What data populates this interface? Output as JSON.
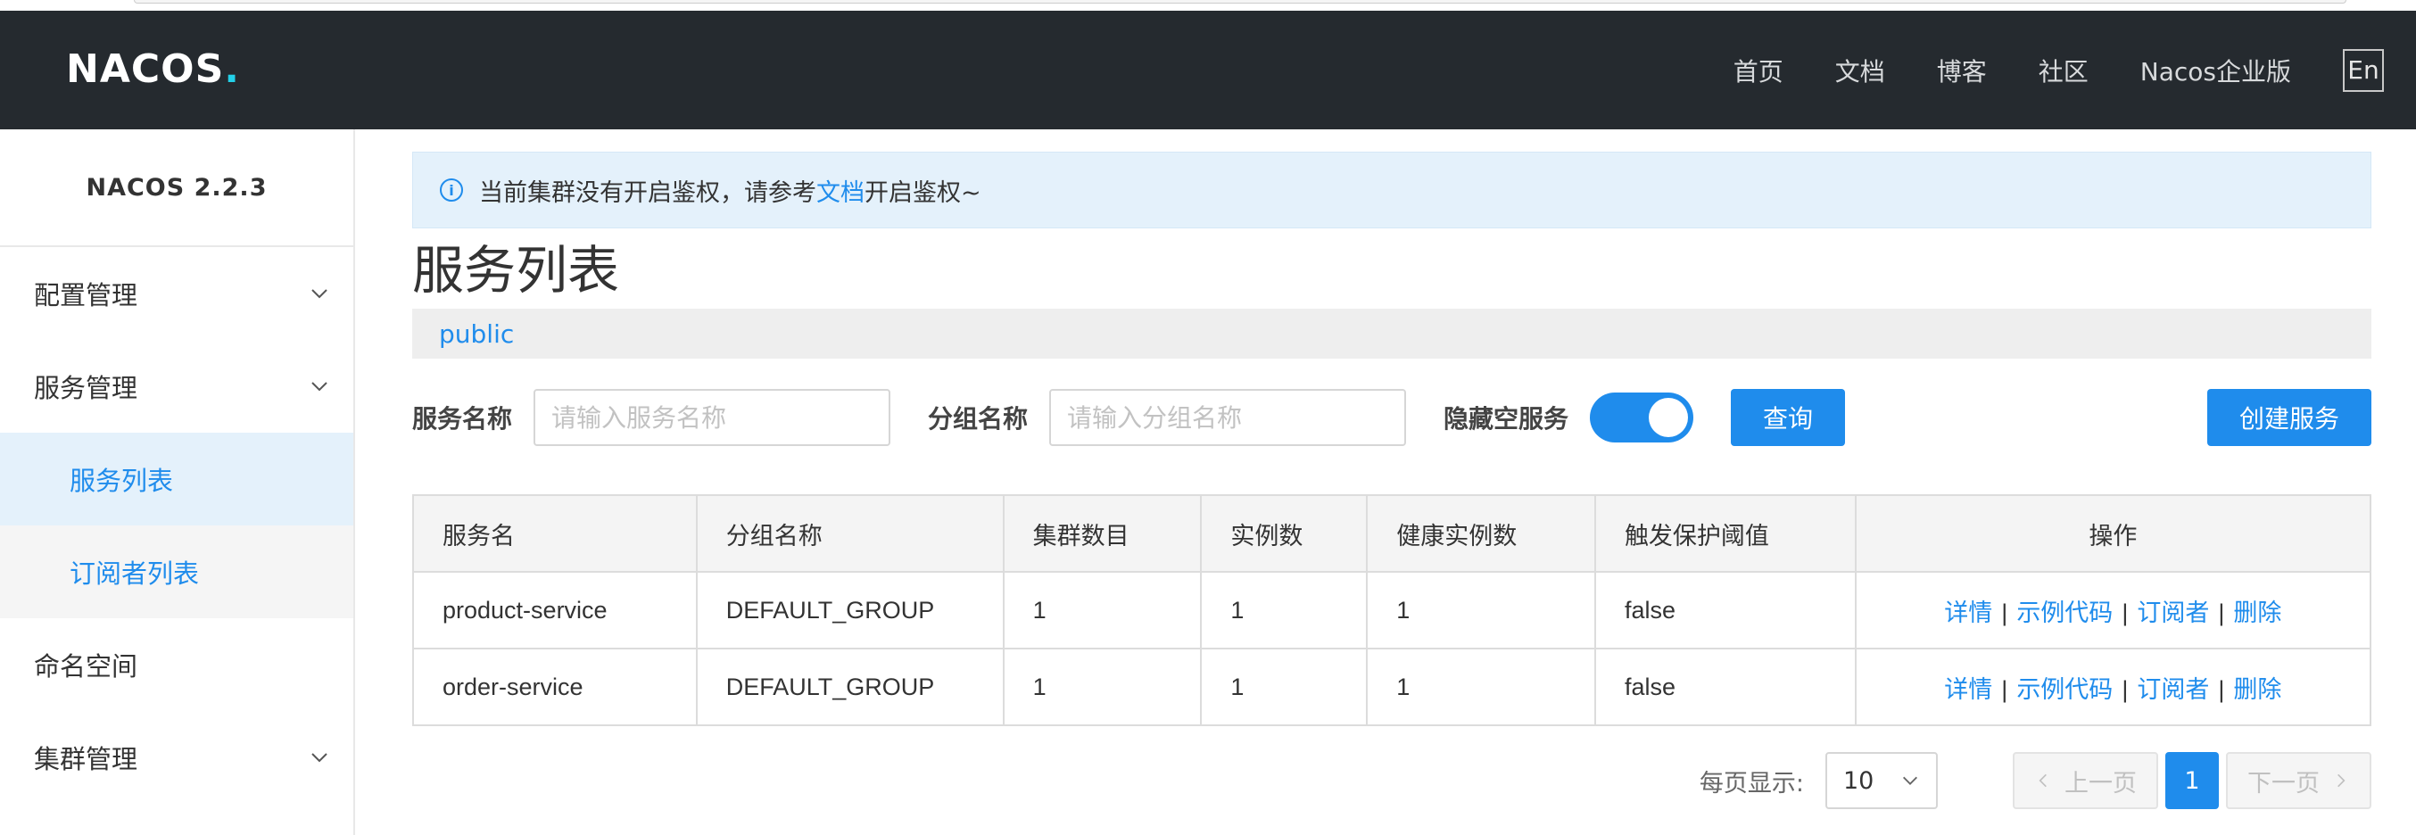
{
  "header": {
    "logo": {
      "text": "NACOS",
      "dot": "."
    },
    "nav": [
      "首页",
      "文档",
      "博客",
      "社区",
      "Nacos企业版"
    ],
    "lang": "En"
  },
  "sidebar": {
    "title": "NACOS 2.2.3",
    "items": [
      {
        "label": "配置管理",
        "expandable": true
      },
      {
        "label": "服务管理",
        "expandable": true
      },
      {
        "label": "服务列表",
        "sub": true,
        "active": true
      },
      {
        "label": "订阅者列表",
        "sub": true
      },
      {
        "label": "命名空间"
      },
      {
        "label": "集群管理",
        "expandable": true
      }
    ]
  },
  "notice": {
    "before": "当前集群没有开启鉴权，请参考",
    "link": "文档",
    "after": "开启鉴权~"
  },
  "page": {
    "title": "服务列表",
    "namespace": "public"
  },
  "filter": {
    "service_name_label": "服务名称",
    "service_name_placeholder": "请输入服务名称",
    "group_name_label": "分组名称",
    "group_name_placeholder": "请输入分组名称",
    "hide_empty_label": "隐藏空服务",
    "hide_empty_on": true,
    "query_label": "查询",
    "create_label": "创建服务"
  },
  "table": {
    "headers": [
      "服务名",
      "分组名称",
      "集群数目",
      "实例数",
      "健康实例数",
      "触发保护阈值",
      "操作"
    ],
    "rows": [
      [
        "product-service",
        "DEFAULT_GROUP",
        "1",
        "1",
        "1",
        "false"
      ],
      [
        "order-service",
        "DEFAULT_GROUP",
        "1",
        "1",
        "1",
        "false"
      ]
    ],
    "ops": [
      "详情",
      "示例代码",
      "订阅者",
      "删除"
    ],
    "op_sep": "|"
  },
  "pagination": {
    "per_page_label": "每页显示:",
    "per_page": "10",
    "prev_label": "上一页",
    "next_label": "下一页",
    "current_page": "1"
  },
  "colors": {
    "accent": "#1f8cec",
    "header_bg": "#252a2f",
    "notice_bg": "#e4f1fb"
  }
}
